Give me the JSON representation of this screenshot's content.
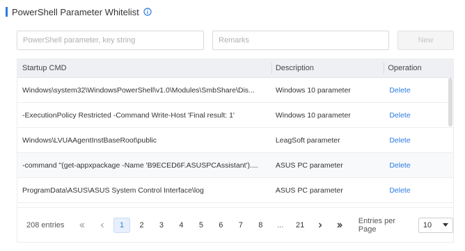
{
  "header": {
    "title": "PowerShell Parameter Whitelist",
    "info_icon": "info-circle-icon"
  },
  "filters": {
    "param_placeholder": "PowerShell parameter, key string",
    "param_value": "",
    "remarks_placeholder": "Remarks",
    "remarks_value": "",
    "new_label": "New"
  },
  "table": {
    "columns": [
      "Startup CMD",
      "Description",
      "Operation"
    ],
    "rows": [
      {
        "cmd": "Windows\\system32\\WindowsPowerShell\\v1.0\\Modules\\SmbShare\\Dis...",
        "desc": "Windows 10 parameter",
        "op": "Delete"
      },
      {
        "cmd": "-ExecutionPolicy Restricted -Command Write-Host 'Final result: 1'",
        "desc": "Windows 10 parameter",
        "op": "Delete"
      },
      {
        "cmd": "Windows\\LVUAAgentInstBaseRoot\\public",
        "desc": "LeagSoft parameter",
        "op": "Delete"
      },
      {
        "cmd": "-command \"(get-appxpackage -Name 'B9ECED6F.ASUSPCAssistant')....",
        "desc": "ASUS PC parameter",
        "op": "Delete"
      },
      {
        "cmd": "ProgramData\\ASUS\\ASUS System Control Interface\\log",
        "desc": "ASUS PC parameter",
        "op": "Delete"
      }
    ]
  },
  "pagination": {
    "total": "208 entries",
    "first_icon": "double-chevron-left-icon",
    "prev_icon": "chevron-left-icon",
    "pages": [
      "1",
      "2",
      "3",
      "4",
      "5",
      "6",
      "7",
      "8"
    ],
    "current_page": "1",
    "ellipsis": "...",
    "last_page": "21",
    "next_icon": "chevron-right-icon",
    "last_icon": "double-chevron-right-icon",
    "per_page_label": "Entries per Page",
    "per_page_value": "10"
  },
  "colors": {
    "accent": "#2a7ae2",
    "header_bg": "#eef0f3"
  }
}
